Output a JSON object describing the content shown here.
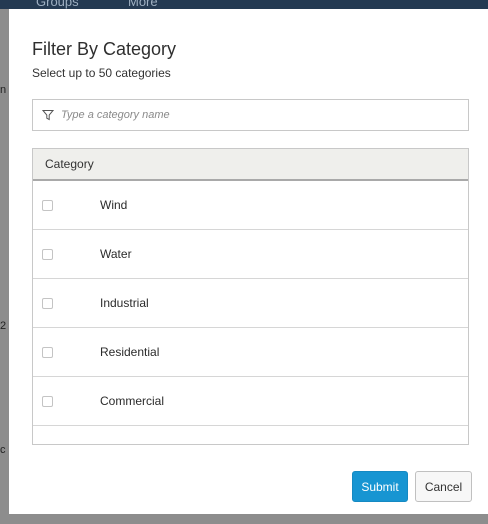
{
  "background": {
    "nav_items": [
      "Groups",
      "More"
    ],
    "fragments": [
      "n",
      "2",
      "c"
    ]
  },
  "modal": {
    "title": "Filter By Category",
    "subtitle": "Select up to 50 categories",
    "search": {
      "placeholder": "Type a category name",
      "value": "",
      "icon": "filter-icon"
    },
    "table": {
      "header": "Category",
      "rows": [
        {
          "label": "Wind",
          "checked": false
        },
        {
          "label": "Water",
          "checked": false
        },
        {
          "label": "Industrial",
          "checked": false
        },
        {
          "label": "Residential",
          "checked": false
        },
        {
          "label": "Commercial",
          "checked": false
        }
      ]
    },
    "buttons": {
      "submit": "Submit",
      "cancel": "Cancel"
    }
  },
  "colors": {
    "accent": "#1795d2",
    "header_bg": "#efefec",
    "topbar": "#243a52"
  }
}
